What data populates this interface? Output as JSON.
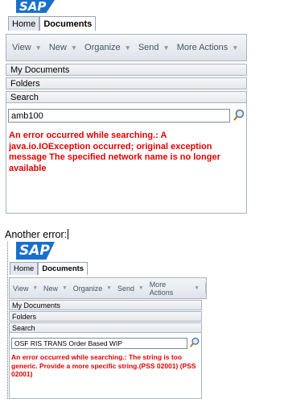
{
  "top": {
    "logo_text": "SAP",
    "tabs": [
      "Home",
      "Documents"
    ],
    "toolbar": [
      "View",
      "New",
      "Organize",
      "Send",
      "More Actions"
    ],
    "sections": [
      "My Documents",
      "Folders",
      "Search"
    ],
    "search_value": "amb100",
    "error": "An error occurred while searching.: A java.io.IOException occurred; original exception message The specified network name is no longer available"
  },
  "caption": "Another error:",
  "bottom": {
    "logo_text": "SAP",
    "tabs": [
      "Home",
      "Documents"
    ],
    "toolbar": [
      "View",
      "New",
      "Organize",
      "Send",
      "More Actions"
    ],
    "sections": [
      "My Documents",
      "Folders",
      "Search"
    ],
    "search_value": "OSF RIS TRANS Order Based WIP",
    "error": "An error occurred while searching.: The string is too generic. Provide a more specific string.(PSS 02001) (PSS 02001)"
  },
  "colors": {
    "error": "#e00000",
    "sap_blue": "#1a6fc9",
    "toolbar_text": "#4a5564"
  },
  "icons": {
    "search": "magnifier-icon",
    "dropdown": "caret-down-icon"
  }
}
